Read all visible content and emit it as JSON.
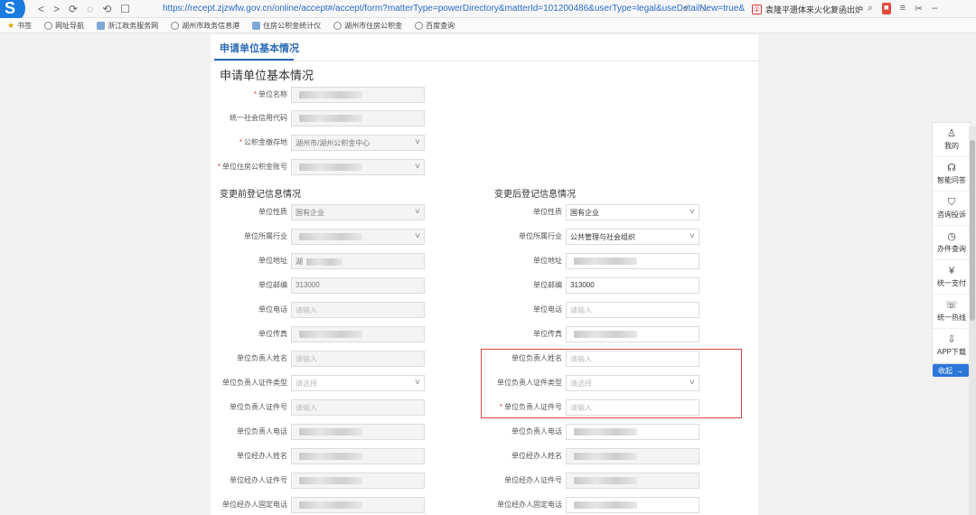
{
  "browser": {
    "nav": [
      "<",
      ">",
      "⟳",
      "◌",
      "⟲",
      "☐"
    ],
    "url": "https://recept.zjzwfw.gov.cn/online/accept#/accept/form?matterType=powerDirectory&matterId=101200486&userType=legal&useDetailNew=true&",
    "ad_badge": "①",
    "ad_text": "袁隆平遗体来火化复函出炉",
    "tools": [
      "⚡",
      "☆",
      "⌕"
    ]
  },
  "bookmarks": [
    {
      "icon": "star",
      "label": "书签"
    },
    {
      "icon": "globe",
      "label": "网址导航"
    },
    {
      "icon": "box",
      "label": "浙江政务服务网"
    },
    {
      "icon": "globe",
      "label": "湖州市政务信息港"
    },
    {
      "icon": "box",
      "label": "住房公积金统计仪"
    },
    {
      "icon": "globe",
      "label": "湖州市住房公积金"
    },
    {
      "icon": "globe",
      "label": "百度查询"
    }
  ],
  "tab": {
    "active_label": "申请单位基本情况"
  },
  "section_title": "申请单位基本情况",
  "basic_fields": [
    {
      "label": "单位名称",
      "required": true,
      "value": "",
      "type": "text"
    },
    {
      "label": "统一社会信用代码",
      "required": false,
      "value": "",
      "type": "text"
    },
    {
      "label": "公积金缴存地",
      "required": true,
      "value": "湖州市/湖州公积金中心",
      "type": "select"
    },
    {
      "label": "单位住房公积金账号",
      "required": true,
      "value": "",
      "type": "select"
    }
  ],
  "before_title": "变更前登记信息情况",
  "after_title": "变更后登记信息情况",
  "before_fields": [
    {
      "label": "单位性质",
      "value": "国有企业",
      "type": "select",
      "style": "grey"
    },
    {
      "label": "单位所属行业",
      "value": "",
      "type": "select",
      "style": "grey"
    },
    {
      "label": "单位地址",
      "value": "湖",
      "type": "text",
      "style": "grey"
    },
    {
      "label": "单位邮编",
      "value": "313000",
      "type": "text",
      "style": "grey"
    },
    {
      "label": "单位电话",
      "value": "请输入",
      "type": "text",
      "style": "grey"
    },
    {
      "label": "单位传真",
      "value": "",
      "type": "text",
      "style": "grey"
    },
    {
      "label": "单位负责人姓名",
      "value": "请输入",
      "type": "text",
      "style": "grey"
    },
    {
      "label": "单位负责人证件类型",
      "value": "请选择",
      "type": "select",
      "style": "white-ph"
    },
    {
      "label": "单位负责人证件号",
      "value": "请输入",
      "type": "text",
      "style": "grey"
    },
    {
      "label": "单位负责人电话",
      "value": "",
      "type": "text",
      "style": "grey"
    },
    {
      "label": "单位经办人姓名",
      "value": "",
      "type": "text",
      "style": "grey"
    },
    {
      "label": "单位经办人证件号",
      "value": "",
      "type": "text",
      "style": "grey"
    },
    {
      "label": "单位经办人固定电话",
      "value": "",
      "type": "text",
      "style": "grey"
    }
  ],
  "after_fields": [
    {
      "label": "单位性质",
      "required": false,
      "value": "国有企业",
      "type": "select",
      "style": "white"
    },
    {
      "label": "单位所属行业",
      "required": false,
      "value": "公共管理与社会组织",
      "type": "select",
      "style": "white"
    },
    {
      "label": "单位地址",
      "required": false,
      "value": "",
      "type": "text",
      "style": "white"
    },
    {
      "label": "单位邮编",
      "required": false,
      "value": "313000",
      "type": "text",
      "style": "white"
    },
    {
      "label": "单位电话",
      "required": false,
      "value": "请输入",
      "type": "text",
      "style": "white-ph"
    },
    {
      "label": "单位传真",
      "required": false,
      "value": "",
      "type": "text",
      "style": "white"
    },
    {
      "label": "单位负责人姓名",
      "required": false,
      "value": "请输入",
      "type": "text",
      "style": "white-ph"
    },
    {
      "label": "单位负责人证件类型",
      "required": false,
      "value": "请选择",
      "type": "select",
      "style": "white-ph"
    },
    {
      "label": "单位负责人证件号",
      "required": true,
      "value": "请输入",
      "type": "text",
      "style": "white-ph"
    },
    {
      "label": "单位负责人电话",
      "required": false,
      "value": "",
      "type": "text",
      "style": "white"
    },
    {
      "label": "单位经办人姓名",
      "required": false,
      "value": "",
      "type": "text",
      "style": "grey"
    },
    {
      "label": "单位经办人证件号",
      "required": false,
      "value": "",
      "type": "text",
      "style": "grey"
    },
    {
      "label": "单位经办人固定电话",
      "required": false,
      "value": "",
      "type": "text",
      "style": "white"
    }
  ],
  "side_panel": {
    "items": [
      {
        "icon": "person-icon",
        "glyph": "♙",
        "label": "我的"
      },
      {
        "icon": "headset-icon",
        "glyph": "☊",
        "label": "智能问答"
      },
      {
        "icon": "shield-icon",
        "glyph": "⛉",
        "label": "咨询投诉"
      },
      {
        "icon": "clock-icon",
        "glyph": "◷",
        "label": "办件查询"
      },
      {
        "icon": "yen-icon",
        "glyph": "¥",
        "label": "统一支付"
      },
      {
        "icon": "phone-icon",
        "glyph": "☏",
        "label": "统一热线"
      },
      {
        "icon": "download-icon",
        "glyph": "⇩",
        "label": "APP下载"
      }
    ],
    "toggle_label": "收起",
    "toggle_glyph": "→"
  }
}
